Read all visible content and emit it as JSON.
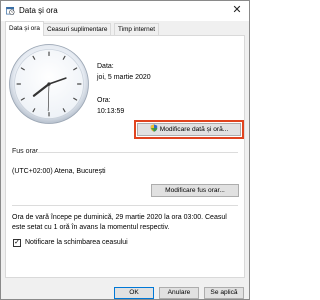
{
  "window": {
    "title": "Data și ora",
    "close_glyph": "✕"
  },
  "tabs": [
    {
      "label": "Data și ora"
    },
    {
      "label": "Ceasuri suplimentare"
    },
    {
      "label": "Timp internet"
    }
  ],
  "date_time": {
    "date_label": "Data:",
    "date_value": "joi, 5 martie 2020",
    "time_label": "Ora:",
    "time_value": "10:13:59",
    "change_button": "Modificare dată și oră..."
  },
  "timezone": {
    "section_label": "Fus orar",
    "value": "(UTC+02:00) Atena, București",
    "change_button": "Modificare fus orar..."
  },
  "dst_notice": "Ora de vară începe pe duminică, 29 martie 2020 la ora 03:00. Ceasul este setat cu 1 oră în avans la momentul respectiv.",
  "notify": {
    "label": "Notificare la schimbarea ceasului",
    "checked": true,
    "check_glyph": "✓"
  },
  "footer": {
    "ok": "OK",
    "cancel": "Anulare",
    "apply": "Se aplică"
  },
  "icons": {
    "title_icon": "calendar-clock-icon",
    "shield": "uac-shield-icon"
  },
  "colors": {
    "highlight": "#e0441f",
    "accent": "#0078d7"
  }
}
